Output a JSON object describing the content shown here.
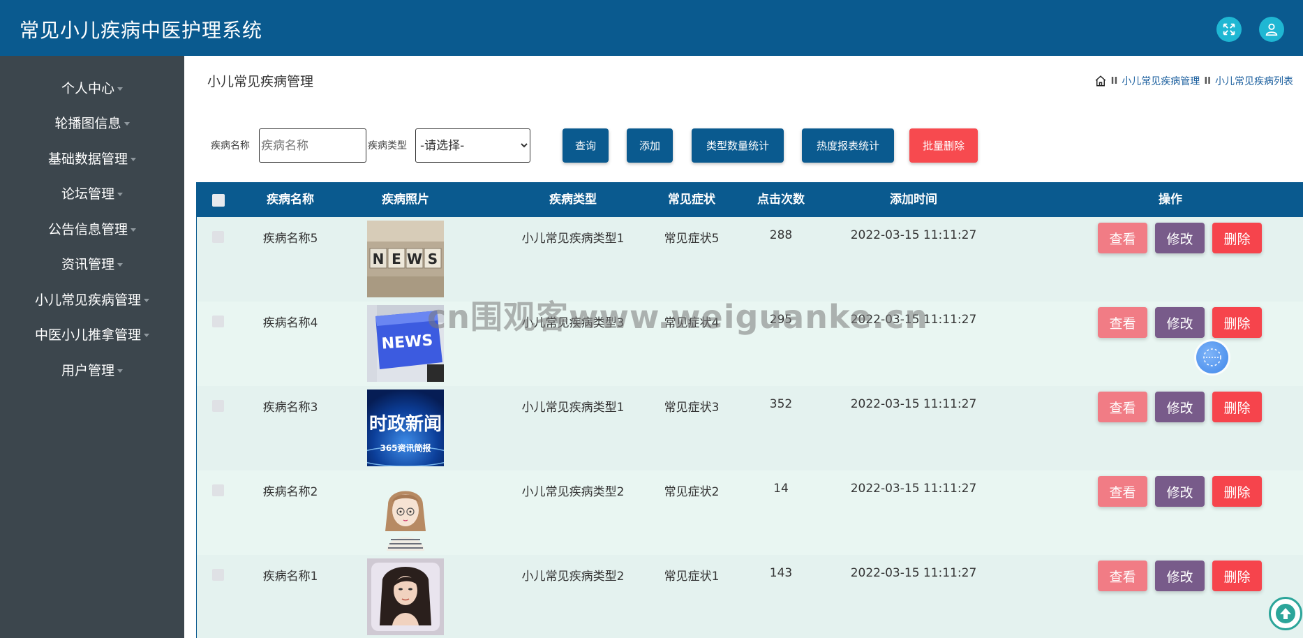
{
  "app": {
    "title": "常见小儿疾病中医护理系统"
  },
  "header": {
    "fullscreen_icon": "expand-arrows-icon",
    "user_icon": "user-icon",
    "accent": "#1fb7d3",
    "bg": "#0a5a8f"
  },
  "sidebar": {
    "items": [
      {
        "label": "个人中心"
      },
      {
        "label": "轮播图信息"
      },
      {
        "label": "基础数据管理"
      },
      {
        "label": "论坛管理"
      },
      {
        "label": "公告信息管理"
      },
      {
        "label": "资讯管理"
      },
      {
        "label": "小儿常见疾病管理"
      },
      {
        "label": "中医小儿推拿管理"
      },
      {
        "label": "用户管理"
      }
    ]
  },
  "page": {
    "title": "小儿常见疾病管理",
    "breadcrumb": {
      "home_icon": "home-icon",
      "sep": "II",
      "items": [
        "小儿常见疾病管理",
        "小儿常见疾病列表"
      ]
    }
  },
  "filters": {
    "name_label": "疾病名称",
    "name_placeholder": "疾病名称",
    "type_label": "疾病类型",
    "type_selected": "-请选择-"
  },
  "toolbar": {
    "query": "查询",
    "add": "添加",
    "type_stats": "类型数量统计",
    "heat_stats": "热度报表统计",
    "batch_delete": "批量删除"
  },
  "table": {
    "headers": {
      "name": "疾病名称",
      "photo": "疾病照片",
      "type": "疾病类型",
      "symptom": "常见症状",
      "clicks": "点击次数",
      "time": "添加时间",
      "ops": "操作"
    },
    "actions": {
      "view": "查看",
      "edit": "修改",
      "delete": "删除"
    },
    "rows": [
      {
        "name": "疾病名称5",
        "photo": "news-blocks-photo",
        "type": "小儿常见疾病类型1",
        "symptom": "常见症状5",
        "clicks": "288",
        "time": "2022-03-15 11:11:27"
      },
      {
        "name": "疾病名称4",
        "photo": "news-keyboard-photo",
        "type": "小儿常见疾病类型3",
        "symptom": "常见症状4",
        "clicks": "295",
        "time": "2022-03-15 11:11:27"
      },
      {
        "name": "疾病名称3",
        "photo": "politics-news-photo",
        "photo_text": "时政新闻",
        "photo_subtext": "365资讯简报",
        "type": "小儿常见疾病类型1",
        "symptom": "常见症状3",
        "clicks": "352",
        "time": "2022-03-15 11:11:27"
      },
      {
        "name": "疾病名称2",
        "photo": "cartoon-girl-photo",
        "type": "小儿常见疾病类型2",
        "symptom": "常见症状2",
        "clicks": "14",
        "time": "2022-03-15 11:11:27"
      },
      {
        "name": "疾病名称1",
        "photo": "portrait-woman-photo",
        "type": "小儿常见疾病类型2",
        "symptom": "常见症状1",
        "clicks": "143",
        "time": "2022-03-15 11:11:27"
      }
    ]
  },
  "overlay": {
    "watermark": "cn围观客www.weiguanke.cn"
  }
}
